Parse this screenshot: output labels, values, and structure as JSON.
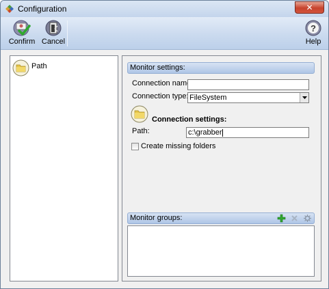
{
  "window": {
    "title": "Configuration",
    "close_label": "✕"
  },
  "toolbar": {
    "confirm_label": "Confirm",
    "cancel_label": "Cancel",
    "help_label": "Help"
  },
  "tree": {
    "items": [
      {
        "label": "Path",
        "icon": "folder-icon"
      }
    ]
  },
  "monitor_settings": {
    "header": "Monitor settings:",
    "connection_name_label": "Connection name:",
    "connection_name_value": "",
    "connection_type_label": "Connection type:",
    "connection_type_value": "FileSystem",
    "connection_settings_title": "Connection settings:",
    "path_label": "Path:",
    "path_value": "c:\\grabber",
    "create_missing_folders_label": "Create missing folders",
    "create_missing_folders_checked": false
  },
  "monitor_groups": {
    "header": "Monitor groups:",
    "icons": [
      "add-icon",
      "remove-icon",
      "settings-icon"
    ]
  },
  "colors": {
    "accent": "#c4d5ec",
    "close_red": "#c7432d",
    "add_green": "#2fa82f"
  }
}
